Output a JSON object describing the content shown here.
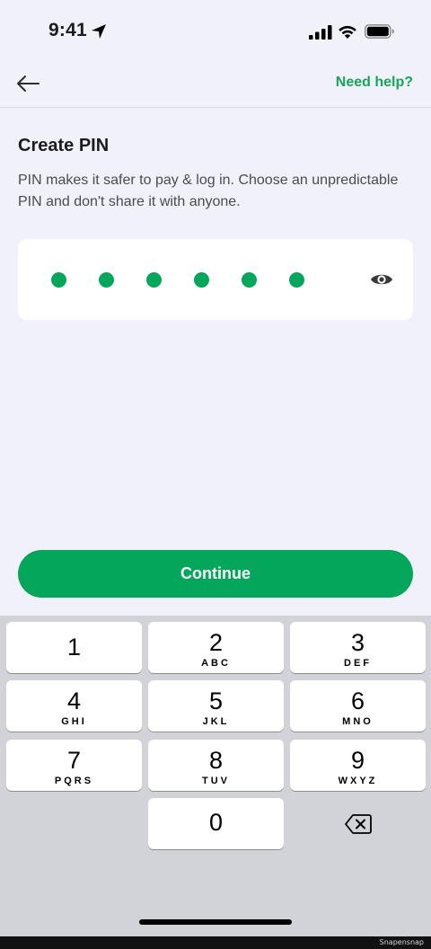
{
  "status_bar": {
    "time": "9:41",
    "icons": [
      "location-arrow-icon",
      "cellular-signal-icon",
      "wifi-icon",
      "battery-icon"
    ]
  },
  "header": {
    "back_icon": "arrow-left-icon",
    "help_label": "Need help?"
  },
  "main": {
    "title": "Create PIN",
    "description": "PIN makes it safer to pay & log in. Choose an unpredictable PIN and don't share it with anyone.",
    "pin": {
      "length": 6,
      "filled": 6,
      "toggle_icon": "eye-icon"
    },
    "continue_label": "Continue"
  },
  "keypad": {
    "keys": [
      {
        "digit": "1",
        "letters": ""
      },
      {
        "digit": "2",
        "letters": "ABC"
      },
      {
        "digit": "3",
        "letters": "DEF"
      },
      {
        "digit": "4",
        "letters": "GHI"
      },
      {
        "digit": "5",
        "letters": "JKL"
      },
      {
        "digit": "6",
        "letters": "MNO"
      },
      {
        "digit": "7",
        "letters": "PQRS"
      },
      {
        "digit": "8",
        "letters": "TUV"
      },
      {
        "digit": "9",
        "letters": "WXYZ"
      },
      {
        "digit": "0",
        "letters": ""
      }
    ],
    "delete_icon": "backspace-icon"
  },
  "watermark": "Snapensnap",
  "colors": {
    "accent": "#03a65a",
    "link": "#16a55c",
    "background": "#f1f2f9",
    "keypad_background": "#d2d3d8"
  }
}
